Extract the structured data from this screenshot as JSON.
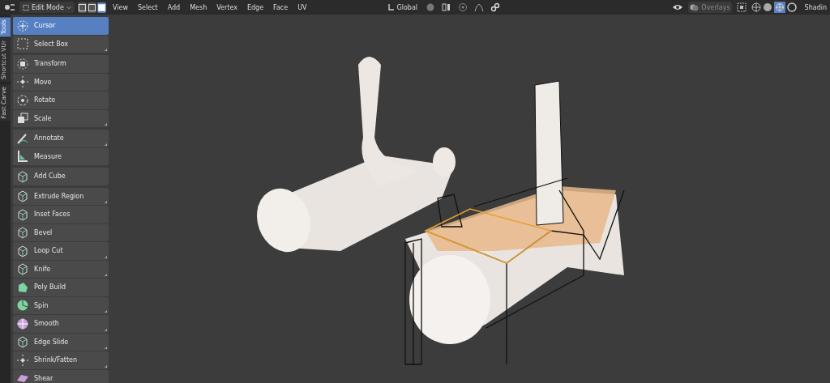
{
  "header": {
    "mode": "Edit Mode",
    "select_modes": [
      {
        "selected": false
      },
      {
        "selected": false
      },
      {
        "selected": true
      }
    ],
    "menus": [
      "View",
      "Select",
      "Add",
      "Mesh",
      "Vertex",
      "Edge",
      "Face",
      "UV"
    ],
    "orientation": "Global",
    "overlays": "Overlays",
    "shading": "Shadin"
  },
  "side_tabs": [
    {
      "label": "Tools",
      "selected": true
    },
    {
      "label": "Shortcut VUr",
      "selected": false
    },
    {
      "label": "Fast Carve",
      "selected": false
    }
  ],
  "tool_groups": [
    [
      {
        "label": "Cursor",
        "selected": true,
        "has_menu": false
      },
      {
        "label": "Select Box",
        "selected": false,
        "has_menu": true
      }
    ],
    [
      {
        "label": "Transform",
        "selected": false,
        "has_menu": false
      },
      {
        "label": "Move",
        "selected": false,
        "has_menu": false
      },
      {
        "label": "Rotate",
        "selected": false,
        "has_menu": false
      },
      {
        "label": "Scale",
        "selected": false,
        "has_menu": true
      }
    ],
    [
      {
        "label": "Annotate",
        "selected": false,
        "has_menu": true
      },
      {
        "label": "Measure",
        "selected": false,
        "has_menu": false
      }
    ],
    [
      {
        "label": "Add Cube",
        "selected": false,
        "has_menu": false
      }
    ],
    [
      {
        "label": "Extrude Region",
        "selected": false,
        "has_menu": true
      },
      {
        "label": "Inset Faces",
        "selected": false,
        "has_menu": false
      },
      {
        "label": "Bevel",
        "selected": false,
        "has_menu": false
      },
      {
        "label": "Loop Cut",
        "selected": false,
        "has_menu": true
      },
      {
        "label": "Knife",
        "selected": false,
        "has_menu": true
      },
      {
        "label": "Poly Build",
        "selected": false,
        "has_menu": false
      },
      {
        "label": "Spin",
        "selected": false,
        "has_menu": true
      },
      {
        "label": "Smooth",
        "selected": false,
        "has_menu": true
      },
      {
        "label": "Edge Slide",
        "selected": false,
        "has_menu": true
      },
      {
        "label": "Shrink/Fatten",
        "selected": false,
        "has_menu": true
      },
      {
        "label": "Shear",
        "selected": false,
        "has_menu": false
      }
    ]
  ]
}
